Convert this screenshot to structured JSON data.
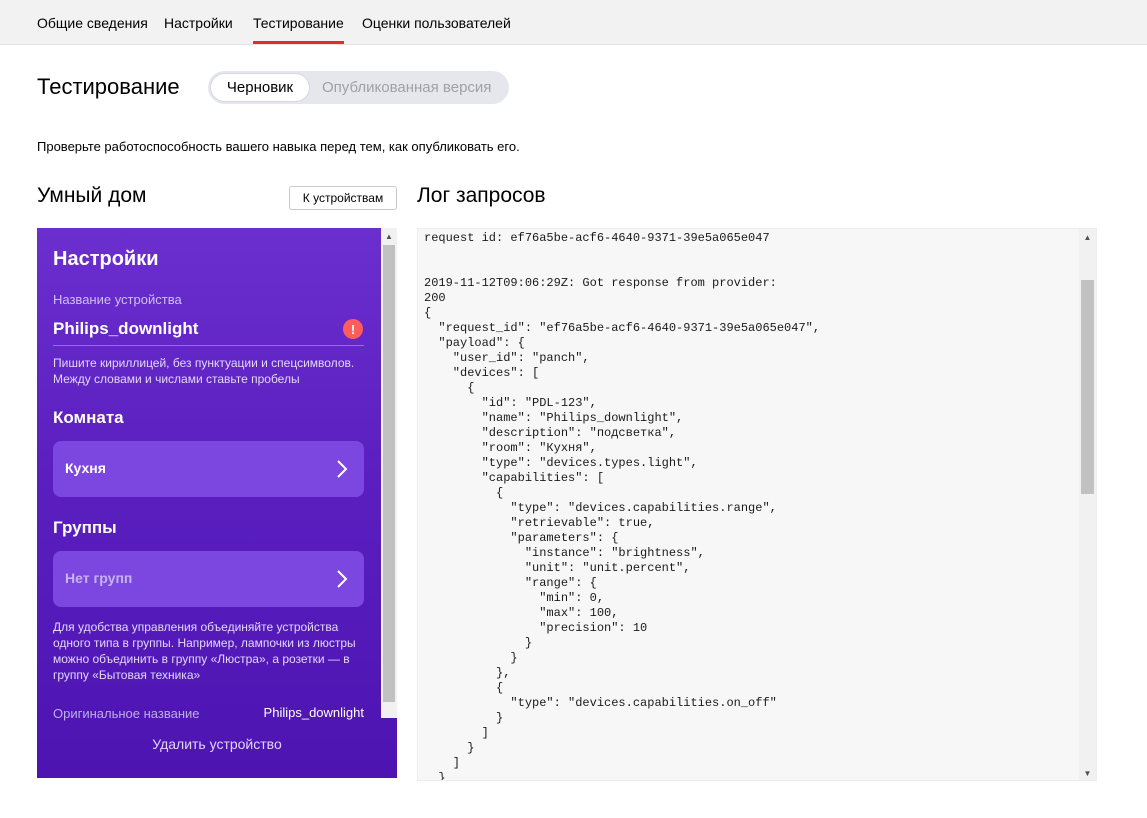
{
  "nav": {
    "tabs": [
      {
        "label": "Общие сведения"
      },
      {
        "label": "Настройки"
      },
      {
        "label": "Тестирование"
      },
      {
        "label": "Оценки пользователей"
      }
    ],
    "active_tab": "Тестирование"
  },
  "header": {
    "title": "Тестирование",
    "switch": {
      "draft": "Черновик",
      "published": "Опубликованная версия",
      "selected": "Черновик"
    }
  },
  "intro": "Проверьте работоспособность вашего навыка перед тем, как опубликовать его.",
  "smart_home": {
    "title": "Умный дом",
    "devices_button": "К устройствам",
    "panel": {
      "title": "Настройки",
      "name_label": "Название устройства",
      "name_value": "Philips_downlight",
      "warning_icon": "!",
      "name_hint": "Пишите кириллицей, без пунктуации и спецсимволов. Между словами и числами ставьте пробелы",
      "room_title": "Комната",
      "room_value": "Кухня",
      "groups_title": "Группы",
      "groups_value": "Нет групп",
      "groups_hint": "Для удобства управления объединяйте устройства одного типа в группы. Например, лампочки из люстры можно объединить в группу «Люстра», а розетки — в группу «Бытовая техника»",
      "original_label": "Оригинальное название",
      "original_value": "Philips_downlight",
      "delete_label": "Удалить устройство"
    }
  },
  "log": {
    "title": "Лог запросов",
    "content": "request id: ef76a5be-acf6-4640-9371-39e5a065e047\n\n\n2019-11-12T09:06:29Z: Got response from provider:\n200\n{\n  \"request_id\": \"ef76a5be-acf6-4640-9371-39e5a065e047\",\n  \"payload\": {\n    \"user_id\": \"panch\",\n    \"devices\": [\n      {\n        \"id\": \"PDL-123\",\n        \"name\": \"Philips_downlight\",\n        \"description\": \"подсветка\",\n        \"room\": \"Кухня\",\n        \"type\": \"devices.types.light\",\n        \"capabilities\": [\n          {\n            \"type\": \"devices.capabilities.range\",\n            \"retrievable\": true,\n            \"parameters\": {\n              \"instance\": \"brightness\",\n              \"unit\": \"unit.percent\",\n              \"range\": {\n                \"min\": 0,\n                \"max\": 100,\n                \"precision\": 10\n              }\n            }\n          },\n          {\n            \"type\": \"devices.capabilities.on_off\"\n          }\n        ]\n      }\n    ]\n  }"
  },
  "colors": {
    "accent": "#e32b2b",
    "panel_top": "#6b2fcf",
    "panel_bottom": "#4d14b2",
    "card": "#7c47e0",
    "warning": "#ff5c5c"
  }
}
